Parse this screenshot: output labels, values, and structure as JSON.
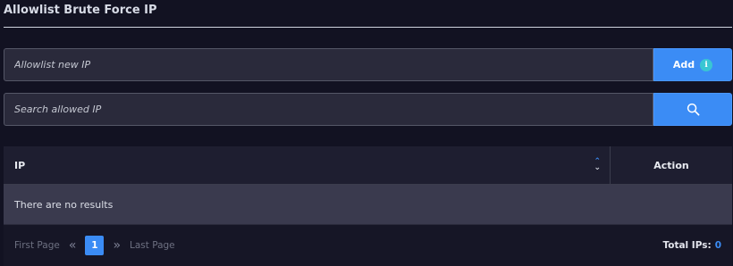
{
  "header": {
    "title": "Allowlist Brute Force IP"
  },
  "allowlist": {
    "placeholder": "Allowlist new IP",
    "add_label": "Add",
    "info_glyph": "i"
  },
  "search": {
    "placeholder": "Search allowed IP",
    "icon": "search-icon"
  },
  "table": {
    "columns": [
      "IP",
      "Action"
    ],
    "empty_message": "There are no results"
  },
  "pagination": {
    "first_label": "First Page",
    "prev_glyph": "«",
    "current_page": "1",
    "next_glyph": "»",
    "last_label": "Last Page"
  },
  "totals": {
    "label": "Total IPs:",
    "value": "0"
  },
  "colors": {
    "accent": "#3b8cf5",
    "background": "#121222",
    "info": "#39c6d3"
  }
}
